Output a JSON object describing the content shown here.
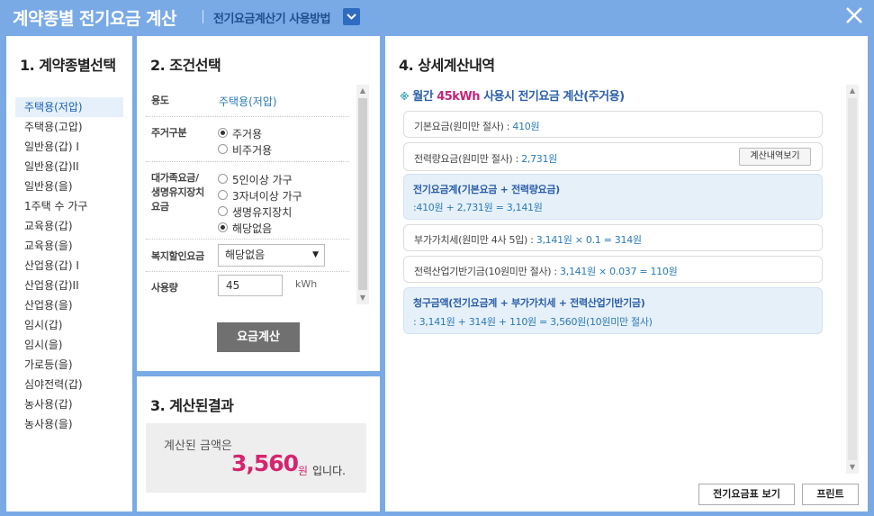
{
  "header": {
    "title": "계약종별 전기요금 계산",
    "howto_label": "전기요금계산기 사용방법"
  },
  "panel1": {
    "title": "1. 계약종별선택",
    "items": [
      "주택용(저압)",
      "주택용(고압)",
      "일반용(갑) I",
      "일반용(갑)II",
      "일반용(을)",
      "1주택 수 가구",
      "교육용(갑)",
      "교육용(을)",
      "산업용(갑) I",
      "산업용(갑)II",
      "산업용(을)",
      "임시(갑)",
      "임시(을)",
      "가로등(을)",
      "심야전력(갑)",
      "농사용(갑)",
      "농사용(을)"
    ],
    "selected_index": 0
  },
  "panel2": {
    "title": "2. 조건선택",
    "usage_label": "용도",
    "usage_value": "주택용(저압)",
    "residence_label": "주거구분",
    "residence_options": [
      "주거용",
      "비주거용"
    ],
    "residence_selected": 0,
    "family_label_1": "대가족요금/",
    "family_label_2": "생명유지장치",
    "family_label_3": "요금",
    "family_options": [
      "5인이상 가구",
      "3자녀이상 가구",
      "생명유지장치",
      "해당없음"
    ],
    "family_selected": 3,
    "welfare_label": "복지할인요금",
    "welfare_value": "해당없음",
    "consumption_label": "사용량",
    "consumption_value": "45",
    "consumption_unit": "kWh",
    "calc_button": "요금계산"
  },
  "panel3": {
    "title": "3. 계산된결과",
    "label": "계산된 금액은",
    "amount": "3,560",
    "unit": "원",
    "suffix": "입니다."
  },
  "panel4": {
    "title": "4. 상세계산내역",
    "subtitle_mark": "※",
    "subtitle_pre": "월간",
    "subtitle_hl": "45kWh",
    "subtitle_post": "사용시 전기요금 계산(주거용)",
    "base_label": "기본요금(원미만 절사) :",
    "base_value": "410원",
    "energy_label": "전력량요금(원미만 절사) :",
    "energy_value": "2,731원",
    "detail_button": "계산내역보기",
    "sum_title": "전기요금계(기본요금 + 전력량요금)",
    "sum_formula": ":410원 + 2,731원 = 3,141원",
    "vat_label": "부가가치세(원미만 4사 5입) :",
    "vat_value": "3,141원 × 0.1 = 314원",
    "fund_label": "전력산업기반기금(10원미만 절사) :",
    "fund_value": "3,141원 × 0.037 = 110원",
    "total_title": "청구금액(전기요금계 + 부가가치세 + 전력산업기반기금)",
    "total_formula": ": 3,141원 + 314원 + 110원 = 3,560원(10원미만 절사)",
    "rate_table_button": "전기요금표 보기",
    "print_button": "프린트"
  }
}
